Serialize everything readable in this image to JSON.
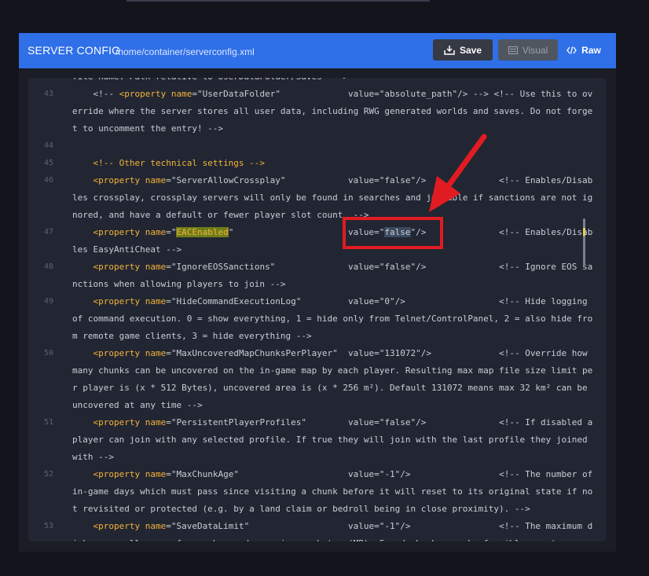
{
  "header": {
    "title": "SERVER CONFIG",
    "path": "/home/container/serverconfig.xml",
    "save_label": "Save",
    "visual_label": "Visual",
    "raw_label": "Raw"
  },
  "editor": {
    "lines": [
      {
        "num": "",
        "text": "file name. Path relative to UserDataFolder/Saves\" -->"
      },
      {
        "num": "43",
        "text": "    <!-- <property name=\"UserDataFolder\"             value=\"absolute_path\"/> --> <!-- Use this to override where the server stores all user data, including RWG generated worlds and saves. Do not forget to uncomment the entry! -->"
      },
      {
        "num": "44",
        "text": ""
      },
      {
        "num": "45",
        "text": "    <!-- Other technical settings -->"
      },
      {
        "num": "46",
        "text": "    <property name=\"ServerAllowCrossplay\"            value=\"false\"/>              <!-- Enables/Disables crossplay, crossplay servers will only be found in searches and joinable if sanctions are not ignored, and have a default or fewer player slot count  -->"
      },
      {
        "num": "47",
        "text": "    <property name=\"EACEnabled\"                      value=\"false\"/>              <!-- Enables/Disables EasyAntiCheat -->"
      },
      {
        "num": "48",
        "text": "    <property name=\"IgnoreEOSSanctions\"              value=\"false\"/>              <!-- Ignore EOS sanctions when allowing players to join -->"
      },
      {
        "num": "49",
        "text": "    <property name=\"HideCommandExecutionLog\"         value=\"0\"/>                  <!-- Hide logging of command execution. 0 = show everything, 1 = hide only from Telnet/ControlPanel, 2 = also hide from remote game clients, 3 = hide everything -->"
      },
      {
        "num": "50",
        "text": "    <property name=\"MaxUncoveredMapChunksPerPlayer\"  value=\"131072\"/>             <!-- Override how many chunks can be uncovered on the in-game map by each player. Resulting max map file size limit per player is (x * 512 Bytes), uncovered area is (x * 256 m²). Default 131072 means max 32 km² can be uncovered at any time -->"
      },
      {
        "num": "51",
        "text": "    <property name=\"PersistentPlayerProfiles\"        value=\"false\"/>              <!-- If disabled a player can join with any selected profile. If true they will join with the last profile they joined with -->"
      },
      {
        "num": "52",
        "text": "    <property name=\"MaxChunkAge\"                     value=\"-1\"/>                 <!-- The number of in-game days which must pass since visiting a chunk before it will reset to its original state if not revisited or protected (e.g. by a land claim or bedroll being in close proximity). -->"
      },
      {
        "num": "53",
        "text": "    <property name=\"SaveDataLimit\"                   value=\"-1\"/>                 <!-- The maximum disk space allowance for each saved game in megabytes (MB). Saved chunks may be forcibly reset"
      }
    ]
  },
  "annotation": {
    "highlighted_value": "false",
    "color": "#e11b22"
  },
  "colors": {
    "header": "#2f6fe8",
    "editor_bg": "#222632",
    "keyword": "#f2b33a"
  },
  "icons": [
    "save-icon",
    "visual-icon",
    "code-icon"
  ]
}
